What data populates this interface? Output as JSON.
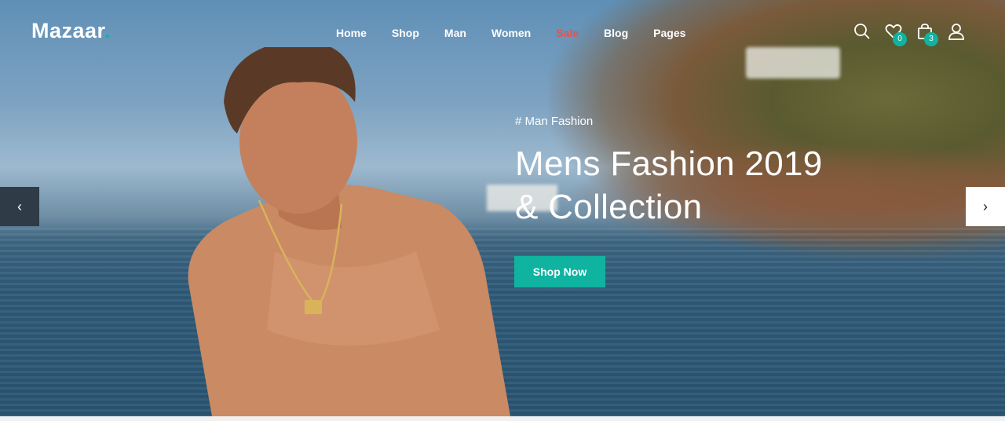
{
  "brand": {
    "name": "Mazaar",
    "dot": ".",
    "accent": "#10b3a0"
  },
  "nav": {
    "items": [
      {
        "label": "Home"
      },
      {
        "label": "Shop"
      },
      {
        "label": "Man"
      },
      {
        "label": "Women"
      },
      {
        "label": "Sale"
      },
      {
        "label": "Blog"
      },
      {
        "label": "Pages"
      }
    ],
    "sale_color": "#e5534b"
  },
  "header_icons": {
    "search": "search-icon",
    "wishlist": {
      "icon": "heart-icon",
      "count": "0"
    },
    "cart": {
      "icon": "bag-icon",
      "count": "3"
    },
    "account": "user-icon"
  },
  "hero": {
    "tag": "# Man Fashion",
    "title_line1": "Mens Fashion 2019",
    "title_line2": "& Collection",
    "cta": "Shop Now",
    "prev": "‹",
    "next": "›"
  }
}
